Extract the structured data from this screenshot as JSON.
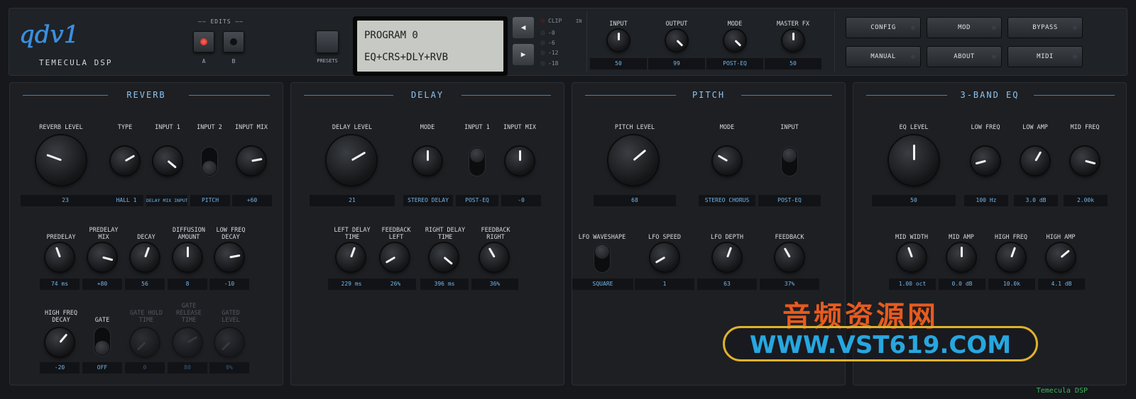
{
  "header": {
    "logo": "qdv1",
    "brand": "TEMECULA DSP",
    "edits_label": "EDITS",
    "edit_a": "A",
    "edit_b": "B",
    "presets": "PRESETS",
    "lcd_line1": "PROGRAM 0",
    "lcd_line2": "EQ+CRS+DLY+RVB",
    "prev_icon": "◀",
    "next_icon": "▶",
    "meter_clip": "CLIP",
    "meter_in": "IN",
    "meter_0": "-0",
    "meter_6": "-6",
    "meter_12": "-12",
    "meter_18": "-18",
    "knobs": {
      "input": "INPUT",
      "output": "OUTPUT",
      "mode": "MODE",
      "master_fx": "MASTER FX"
    },
    "values": {
      "input": "50",
      "output": "99",
      "mode": "POST-EQ",
      "master_fx": "50"
    },
    "buttons": {
      "config": "CONFIG",
      "mod": "MOD",
      "bypass": "BYPASS",
      "manual": "MANUAL",
      "about": "ABOUT",
      "midi": "MIDI"
    }
  },
  "reverb": {
    "title": "REVERB",
    "labels": {
      "level": "REVERB LEVEL",
      "type": "TYPE",
      "in1": "INPUT 1",
      "in2": "INPUT 2",
      "mix": "INPUT MIX",
      "predelay": "PREDELAY",
      "pmix": "PREDELAY\nMIX",
      "decay": "DECAY",
      "diff": "DIFFUSION\nAMOUNT",
      "lowf": "LOW FREQ\nDECAY",
      "highf": "HIGH FREQ\nDECAY",
      "gate": "GATE",
      "ghold": "GATE HOLD\nTIME",
      "grel": "GATE\nRELEASE\nTIME",
      "glevel": "GATED\nLEVEL"
    },
    "values": {
      "level": "23",
      "type": "HALL 1",
      "in1": "DELAY MIX INPUT",
      "in2": "PITCH",
      "mix": "+60",
      "predelay": "74 ms",
      "pmix": "+80",
      "decay": "56",
      "diff": "8",
      "lowf": "-10",
      "highf": "-20",
      "gate": "OFF",
      "ghold": "0",
      "grel": "80",
      "glevel": "0%"
    }
  },
  "delay": {
    "title": "DELAY",
    "labels": {
      "level": "DELAY LEVEL",
      "mode": "MODE",
      "in1": "INPUT 1",
      "mix": "INPUT MIX",
      "ldt": "LEFT DELAY\nTIME",
      "fbl": "FEEDBACK\nLEFT",
      "rdt": "RIGHT DELAY\nTIME",
      "fbr": "FEEDBACK\nRIGHT"
    },
    "values": {
      "level": "21",
      "mode": "STEREO DELAY",
      "in1": "POST-EQ",
      "mix": "-0",
      "ldt": "229 ms",
      "fbl": "26%",
      "rdt": "396 ms",
      "fbr": "36%"
    }
  },
  "pitch": {
    "title": "PITCH",
    "labels": {
      "level": "PITCH LEVEL",
      "mode": "MODE",
      "input": "INPUT",
      "lfow": "LFO WAVESHAPE",
      "lfos": "LFO SPEED",
      "lfod": "LFO DEPTH",
      "fb": "FEEDBACK"
    },
    "values": {
      "level": "68",
      "mode": "STEREO CHORUS",
      "input": "POST-EQ",
      "lfow": "SQUARE",
      "lfos": "1",
      "lfod": "63",
      "fb": "37%"
    }
  },
  "eq": {
    "title": "3-BAND EQ",
    "labels": {
      "level": "EQ LEVEL",
      "lowf": "LOW FREQ",
      "lowa": "LOW AMP",
      "midf": "MID FREQ",
      "midw": "MID WIDTH",
      "mida": "MID AMP",
      "highf": "HIGH FREQ",
      "higha": "HIGH AMP"
    },
    "values": {
      "level": "50",
      "lowf": "100 Hz",
      "lowa": "3.0 dB",
      "midf": "2.00k",
      "midw": "1.00 oct",
      "mida": "0.0 dB",
      "highf": "10.0k",
      "higha": "4.1 dB"
    }
  },
  "watermark": {
    "cn": "音频资源网",
    "url": "WWW.VST619.COM"
  },
  "footer": "Temecula DSP",
  "colors": {
    "accent": "#74b6ea",
    "title": "#8ec3ef",
    "led_red": "#e5322c"
  }
}
